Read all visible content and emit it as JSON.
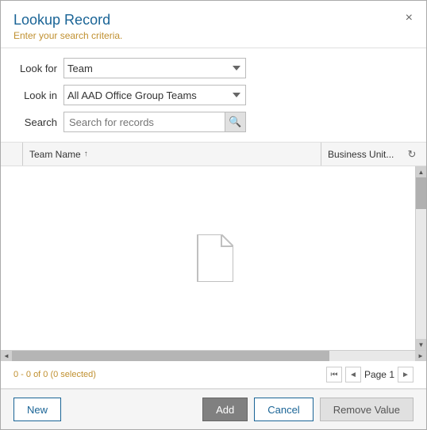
{
  "dialog": {
    "title": "Lookup Record",
    "subtitle": "Enter your search criteria.",
    "close_label": "×"
  },
  "form": {
    "look_for_label": "Look for",
    "look_in_label": "Look in",
    "search_label": "Search",
    "look_for_value": "Team",
    "look_in_value": "All AAD Office Group Teams",
    "search_placeholder": "Search for records",
    "look_for_options": [
      "Team"
    ],
    "look_in_options": [
      "All AAD Office Group Teams"
    ]
  },
  "table": {
    "col_team_name": "Team Name",
    "col_business_unit": "Business Unit...",
    "sort_indicator": "↑",
    "empty_state": "",
    "rows": []
  },
  "status": {
    "record_count": "0 - 0 of 0 (0 selected)"
  },
  "pagination": {
    "page_label": "Page 1"
  },
  "footer": {
    "new_label": "New",
    "add_label": "Add",
    "cancel_label": "Cancel",
    "remove_label": "Remove Value"
  }
}
